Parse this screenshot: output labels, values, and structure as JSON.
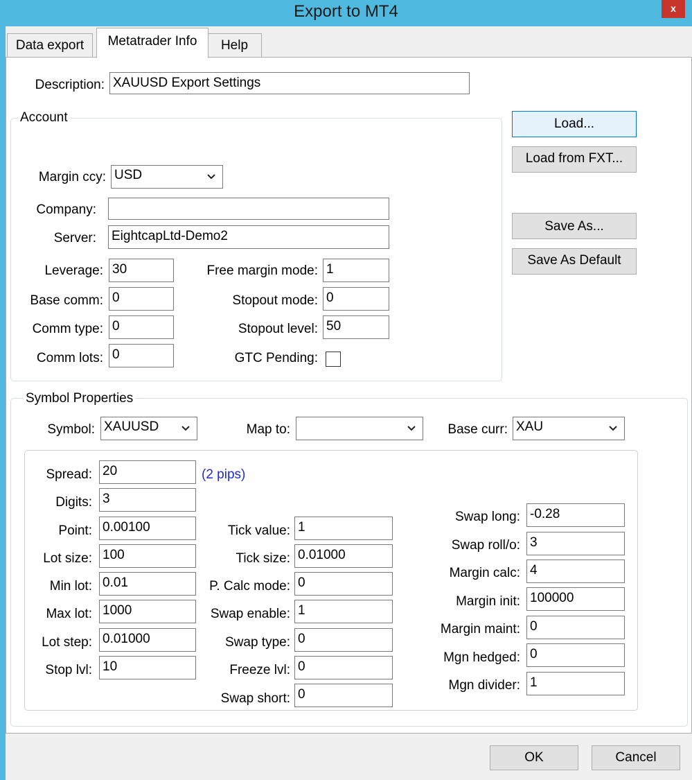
{
  "window": {
    "title": "Export to MT4",
    "close_label": "x"
  },
  "tabs": [
    {
      "label": "Data export",
      "active": false
    },
    {
      "label": "Metatrader Info",
      "active": true
    },
    {
      "label": "Help",
      "active": false
    }
  ],
  "description": {
    "label": "Description:",
    "value": "XAUUSD Export Settings"
  },
  "account": {
    "title": "Account",
    "margin_ccy": {
      "label": "Margin ccy:",
      "value": "USD"
    },
    "company": {
      "label": "Company:",
      "value": ""
    },
    "server": {
      "label": "Server:",
      "value": "EightcapLtd-Demo2"
    },
    "leverage": {
      "label": "Leverage:",
      "value": "30"
    },
    "base_comm": {
      "label": "Base comm:",
      "value": "0"
    },
    "comm_type": {
      "label": "Comm type:",
      "value": "0"
    },
    "comm_lots": {
      "label": "Comm lots:",
      "value": "0"
    },
    "free_margin_mode": {
      "label": "Free margin mode:",
      "value": "1"
    },
    "stopout_mode": {
      "label": "Stopout mode:",
      "value": "0"
    },
    "stopout_level": {
      "label": "Stopout level:",
      "value": "50"
    },
    "gtc_pending": {
      "label": "GTC Pending:",
      "checked": false
    }
  },
  "buttons": {
    "load": "Load...",
    "load_fxt": "Load from FXT...",
    "save_as": "Save As...",
    "save_default": "Save As Default",
    "ok": "OK",
    "cancel": "Cancel"
  },
  "symbol_props": {
    "title": "Symbol Properties",
    "symbol": {
      "label": "Symbol:",
      "value": "XAUUSD"
    },
    "map_to": {
      "label": "Map to:",
      "value": ""
    },
    "base_curr": {
      "label": "Base curr:",
      "value": "XAU"
    },
    "spread": {
      "label": "Spread:",
      "value": "20",
      "note": "(2 pips)"
    },
    "digits": {
      "label": "Digits:",
      "value": "3"
    },
    "point": {
      "label": "Point:",
      "value": "0.00100"
    },
    "lot_size": {
      "label": "Lot size:",
      "value": "100"
    },
    "min_lot": {
      "label": "Min lot:",
      "value": "0.01"
    },
    "max_lot": {
      "label": "Max lot:",
      "value": "1000"
    },
    "lot_step": {
      "label": "Lot step:",
      "value": "0.01000"
    },
    "stop_lvl": {
      "label": "Stop lvl:",
      "value": "10"
    },
    "tick_value": {
      "label": "Tick value:",
      "value": "1"
    },
    "tick_size": {
      "label": "Tick size:",
      "value": "0.01000"
    },
    "p_calc_mode": {
      "label": "P. Calc mode:",
      "value": "0"
    },
    "swap_enable": {
      "label": "Swap enable:",
      "value": "1"
    },
    "swap_type": {
      "label": "Swap type:",
      "value": "0"
    },
    "freeze_lvl": {
      "label": "Freeze lvl:",
      "value": "0"
    },
    "swap_short": {
      "label": "Swap short:",
      "value": "0"
    },
    "swap_long": {
      "label": "Swap long:",
      "value": "-0.28"
    },
    "swap_rollover": {
      "label": "Swap roll/o:",
      "value": "3"
    },
    "margin_calc": {
      "label": "Margin calc:",
      "value": "4"
    },
    "margin_init": {
      "label": "Margin init:",
      "value": "100000"
    },
    "margin_maint": {
      "label": "Margin maint:",
      "value": "0"
    },
    "mgn_hedged": {
      "label": "Mgn hedged:",
      "value": "0"
    },
    "mgn_divider": {
      "label": "Mgn divider:",
      "value": "1"
    }
  }
}
